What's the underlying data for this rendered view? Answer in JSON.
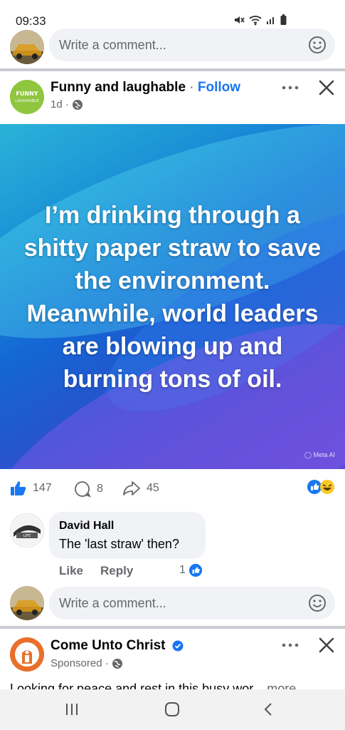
{
  "status_bar": {
    "time": "09:33"
  },
  "top_comment_box": {
    "placeholder": "Write a comment..."
  },
  "post": {
    "page_name": "Funny and laughable",
    "separator": "·",
    "follow_label": "Follow",
    "age": "1d ·",
    "avatar_text": "FUNNY LAUGHABLE",
    "image_text": "I’m drinking through a shitty paper straw to save the environment. Meanwhile, world leaders are blowing up and burning tons of oil.",
    "image_credit": "Meta AI"
  },
  "reactions": {
    "likes": "147",
    "comments": "8",
    "shares": "45"
  },
  "comment": {
    "author": "David Hall",
    "text": "The 'last straw' then?",
    "like_label": "Like",
    "reply_label": "Reply",
    "like_count": "1"
  },
  "bottom_comment_box": {
    "placeholder": "Write a comment..."
  },
  "sponsored_post": {
    "page_name": "Come Unto Christ",
    "label": "Sponsored ·",
    "text": "Looking for peace and rest in this busy wor...",
    "more_label": "more"
  },
  "colors": {
    "facebook_blue": "#1877f2",
    "divider": "#c9ccd1",
    "input_bg": "#f0f2f5"
  }
}
